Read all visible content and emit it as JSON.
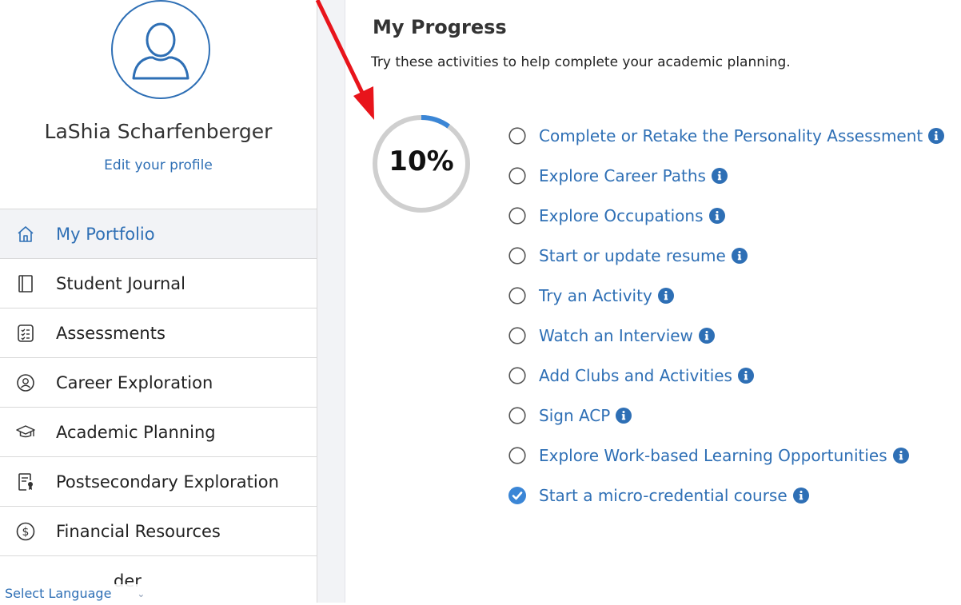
{
  "user": {
    "name": "LaShia Scharfenberger",
    "edit_profile_label": "Edit your profile"
  },
  "sidebar": {
    "items": [
      {
        "label": "My Portfolio",
        "icon": "home-icon",
        "active": true
      },
      {
        "label": "Student Journal",
        "icon": "journal-icon"
      },
      {
        "label": "Assessments",
        "icon": "checklist-icon"
      },
      {
        "label": "Career Exploration",
        "icon": "person-circle-icon"
      },
      {
        "label": "Academic Planning",
        "icon": "graduation-cap-icon"
      },
      {
        "label": "Postsecondary Exploration",
        "icon": "document-award-icon"
      },
      {
        "label": "Financial Resources",
        "icon": "dollar-circle-icon"
      },
      {
        "label": "der",
        "icon": "partial-icon"
      }
    ]
  },
  "language": {
    "label": "Select Language"
  },
  "main": {
    "title": "My Progress",
    "subtitle": "Try these activities to help complete your academic planning.",
    "progress": {
      "percent": 10,
      "label": "10%"
    },
    "activities": [
      {
        "label": "Complete or Retake the Personality Assessment",
        "done": false
      },
      {
        "label": "Explore Career Paths",
        "done": false
      },
      {
        "label": "Explore Occupations",
        "done": false
      },
      {
        "label": "Start or update resume",
        "done": false
      },
      {
        "label": "Try an Activity",
        "done": false
      },
      {
        "label": "Watch an Interview",
        "done": false
      },
      {
        "label": "Add Clubs and Activities",
        "done": false
      },
      {
        "label": "Sign ACP",
        "done": false
      },
      {
        "label": "Explore Work-based Learning Opportunities",
        "done": false
      },
      {
        "label": "Start a micro-credential course",
        "done": true
      }
    ]
  },
  "colors": {
    "accent": "#2e6fb5",
    "check": "#3b86d6",
    "ring_track": "#cfcfcf",
    "annotation": "#e8141b"
  }
}
